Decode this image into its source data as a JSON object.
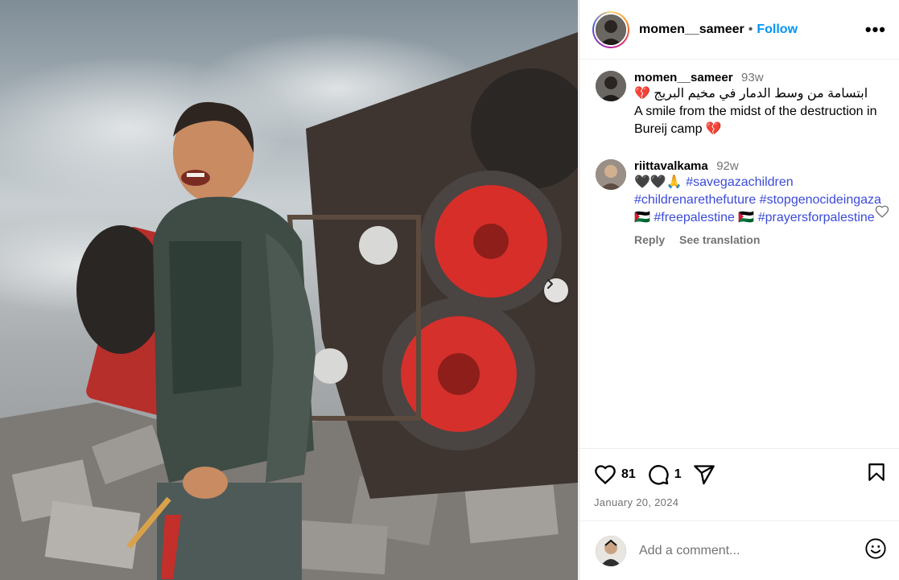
{
  "post": {
    "author": "momen__sameer",
    "follow_label": "Follow",
    "separator": "•",
    "more_label": "•••",
    "caption_time": "93w",
    "caption_arabic": "ابتسامة من وسط الدمار في مخيم البريج 💔",
    "caption_english": "A smile from the midst of the destruction in Bureij camp 💔",
    "likes": "81",
    "comments_count": "1",
    "date": "January 20, 2024"
  },
  "comments": [
    {
      "user": "riittavalkama",
      "time": "92w",
      "hearts": "🖤🖤🙏",
      "tags": [
        "#savegazachildren",
        "#childrenarethefuture",
        "#stopgenocideingaza🇵🇸",
        "#freepalestine",
        "🇵🇸",
        "#prayersforpalestine"
      ],
      "reply_label": "Reply",
      "translate_label": "See translation"
    }
  ],
  "add_comment": {
    "placeholder": "Add a comment..."
  },
  "colors": {
    "accent": "#0095f6",
    "hashtag": "#3b4bd8",
    "muted": "#737373"
  },
  "icons": [
    "chevron-right-icon",
    "more-icon",
    "heart-icon",
    "comment-icon",
    "share-icon",
    "bookmark-icon",
    "emoji-icon"
  ]
}
